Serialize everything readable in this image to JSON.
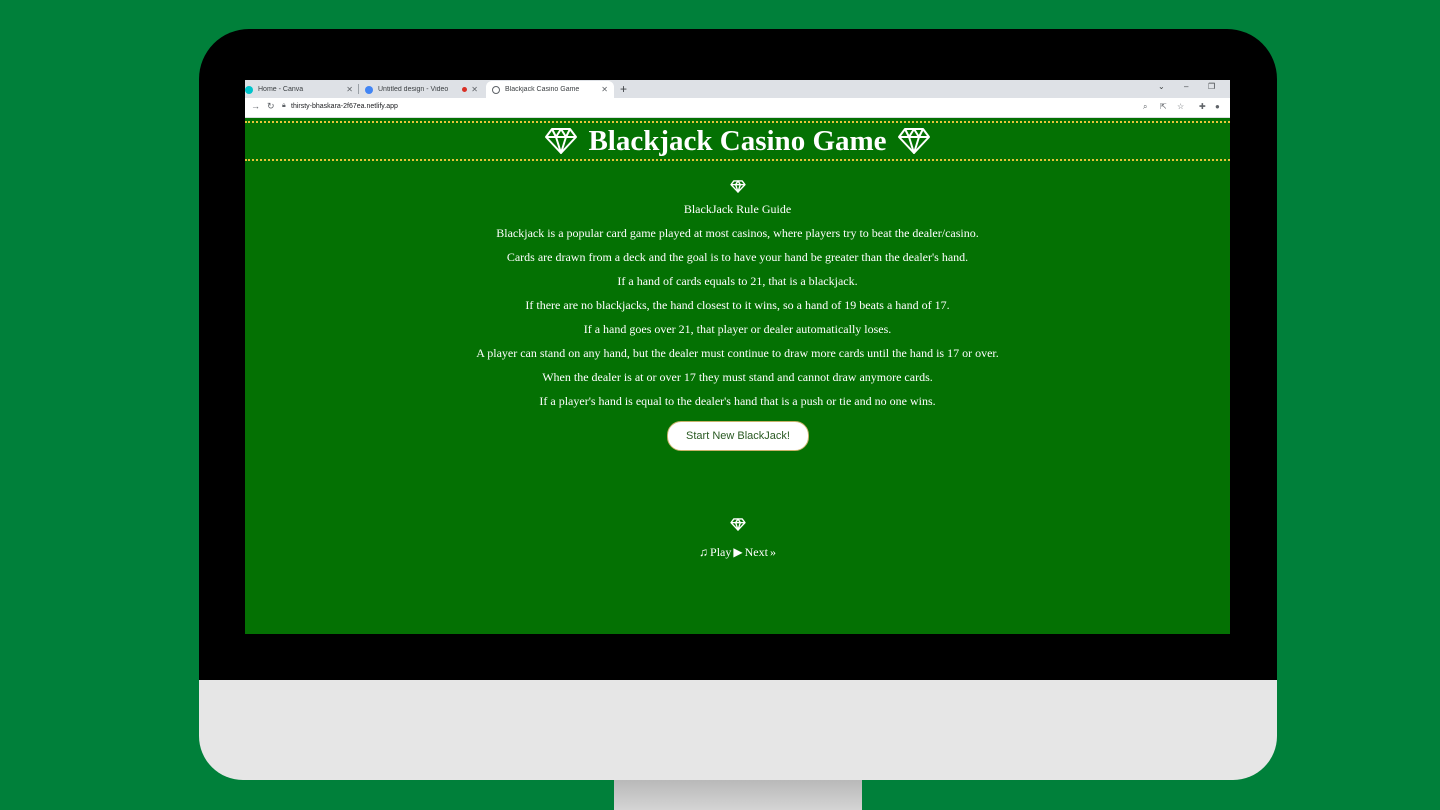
{
  "browser": {
    "tabs": [
      {
        "title": "Home - Canva",
        "active": false
      },
      {
        "title": "Untitled design - Video",
        "active": false
      },
      {
        "title": "Blackjack Casino Game",
        "active": true
      }
    ],
    "url": "thirsty-bhaskara-2f67ea.netlify.app"
  },
  "page": {
    "title": "Blackjack Casino Game",
    "rules_title": "BlackJack Rule Guide",
    "rules": [
      "Blackjack is a popular card game played at most casinos, where players try to beat the dealer/casino.",
      "Cards are drawn from a deck and the goal is to have your hand be greater than the dealer's hand.",
      "If a hand of cards equals to 21, that is a blackjack.",
      "If there are no blackjacks, the hand closest to it wins, so a hand of 19 beats a hand of 17.",
      "If a hand goes over 21, that player or dealer automatically loses.",
      "A player can stand on any hand, but the dealer must continue to draw more cards until the hand is 17 or over.",
      "When the dealer is at or over 17 they must stand and cannot draw anymore cards.",
      "If a player's hand is equal to the dealer's hand that is a push or tie and no one wins."
    ],
    "start_button": "Start New BlackJack!",
    "play_label": "Play",
    "next_label": "Next"
  },
  "colors": {
    "background": "#00803a",
    "page_green": "#047103",
    "header_border": "#e8c53a"
  },
  "icons": [
    "diamond-icon",
    "music-note-icon",
    "play-icon",
    "double-chevron-right-icon"
  ]
}
